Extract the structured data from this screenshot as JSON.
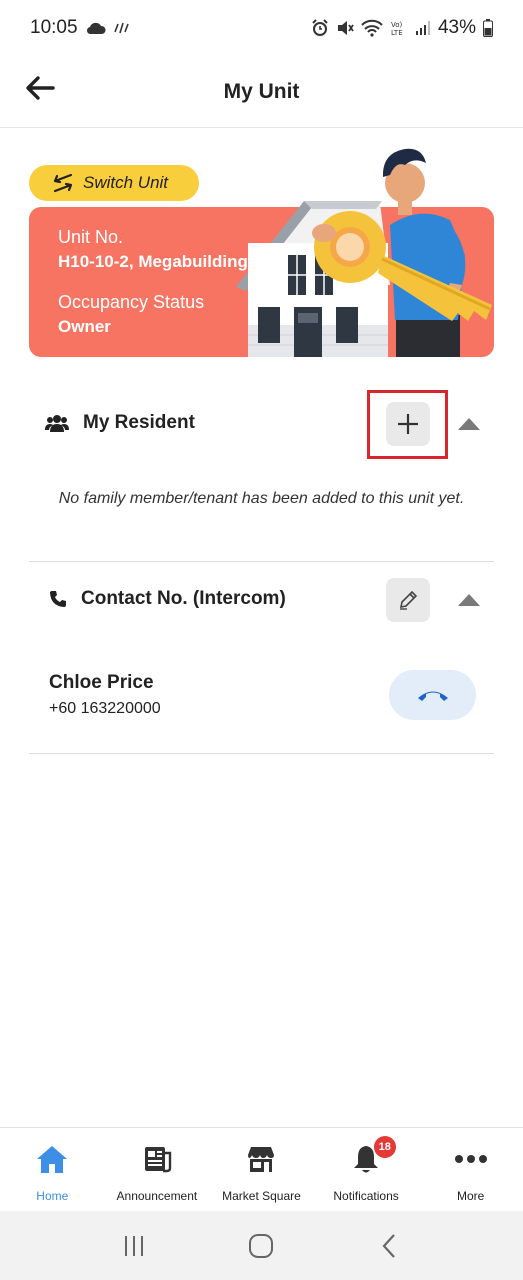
{
  "status_bar": {
    "time": "10:05",
    "battery": "43%"
  },
  "header": {
    "title": "My Unit"
  },
  "unit": {
    "switch_label": "Switch Unit",
    "unit_no_label": "Unit No.",
    "unit_no_value": "H10-10-2, Megabuilding",
    "occupancy_label": "Occupancy Status",
    "occupancy_value": "Owner"
  },
  "residents": {
    "title": "My Resident",
    "empty_message": "No family member/tenant has been added to this unit yet."
  },
  "contact": {
    "title": "Contact No. (Intercom)",
    "name": "Chloe Price",
    "phone": "+60 163220000"
  },
  "bottom_nav": {
    "items": [
      {
        "label": "Home",
        "icon": "home-icon",
        "active": true
      },
      {
        "label": "Announcement",
        "icon": "newspaper-icon"
      },
      {
        "label": "Market Square",
        "icon": "store-icon"
      },
      {
        "label": "Notifications",
        "icon": "bell-icon",
        "badge": "18"
      },
      {
        "label": "More",
        "icon": "more-icon"
      }
    ]
  },
  "colors": {
    "accent": "#3d8ee6",
    "card": "#f87462",
    "switch_button": "#f9ce3c",
    "badge": "#e53935",
    "highlight": "#d7262c"
  }
}
